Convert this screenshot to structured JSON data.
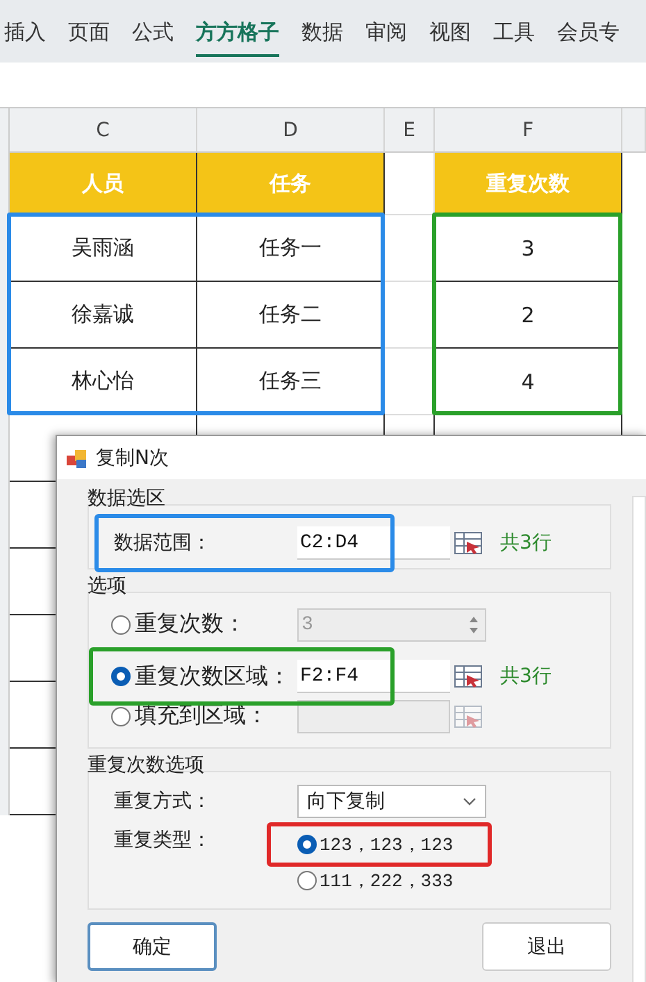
{
  "ribbon_tabs": [
    {
      "label": "插入",
      "selected": false
    },
    {
      "label": "页面",
      "selected": false
    },
    {
      "label": "公式",
      "selected": false
    },
    {
      "label": "方方格子",
      "selected": true
    },
    {
      "label": "数据",
      "selected": false
    },
    {
      "label": "审阅",
      "selected": false
    },
    {
      "label": "视图",
      "selected": false
    },
    {
      "label": "工具",
      "selected": false
    },
    {
      "label": "会员专",
      "selected": false
    }
  ],
  "sheet": {
    "columns": [
      {
        "letter": "C",
        "header": "人员",
        "cells": [
          "吴雨涵",
          "徐嘉诚",
          "林心怡"
        ],
        "color": "#2b8be8"
      },
      {
        "letter": "D",
        "header": "任务",
        "cells": [
          "任务一",
          "任务二",
          "任务三"
        ],
        "color": "#2b8be8"
      },
      {
        "letter": "E"
      },
      {
        "letter": "F",
        "header": "重复次数",
        "cells": [
          "3",
          "2",
          "4"
        ],
        "color": "#2aa02a"
      }
    ]
  },
  "dialog": {
    "title": "复制N次",
    "data_group": {
      "title": "数据选区",
      "label": "数据范围：",
      "value": "C2:D4",
      "count": "共3行",
      "color": "#2b8be8"
    },
    "options_group": {
      "title": "选项",
      "options": [
        {
          "kind": "spinner",
          "label": "重复次数：",
          "value": "3",
          "selected": false,
          "disabled": true
        },
        {
          "kind": "range",
          "label": "重复次数区域：",
          "value": "F2:F4",
          "count": "共3行",
          "selected": true,
          "disabled": false,
          "color": "#2aa02a"
        },
        {
          "kind": "range",
          "label": "填充到区域：",
          "selected": false,
          "disabled": true
        }
      ]
    },
    "repeat_group": {
      "title": "重复次数选项",
      "mode_label": "重复方式：",
      "mode_value": "向下复制",
      "type_label": "重复类型：",
      "types": [
        {
          "label": "123，123，123",
          "selected": true,
          "color": "#e02828"
        },
        {
          "label": "111，222，333",
          "selected": false
        }
      ]
    },
    "buttons": [
      {
        "label": "确定",
        "kind": "default"
      },
      {
        "label": "退出",
        "kind": "normal"
      }
    ]
  }
}
